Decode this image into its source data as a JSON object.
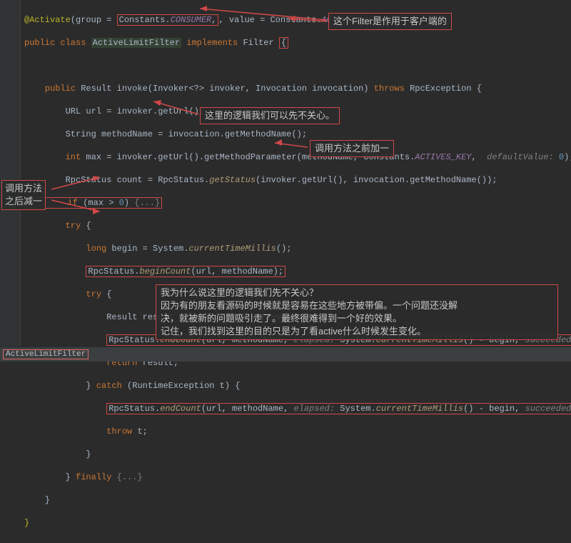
{
  "code": {
    "l1a": "@Activate",
    "l1b": "(group = ",
    "l1c": "Constants.",
    "l1d": "CONSUMER",
    "l1e": ", value = Constants.",
    "l1f": "ACTIVES_KEY",
    "l1g": ")",
    "l2a": "public class ",
    "l2b": "ActiveLimitFilter",
    "l2c": " implements ",
    "l2d": "Filter ",
    "l2e": "{",
    "l3": "",
    "l4a": "    public ",
    "l4b": "Result invoke(Invoker<?> invoker, Invocation invocation) ",
    "l4c": "throws ",
    "l4d": "RpcException {",
    "l5": "        URL url = invoker.getUrl();",
    "l6": "        String methodName = invocation.getMethodName();",
    "l7a": "        int ",
    "l7b": "max = invoker.getUrl().getMethodParameter(methodName, Constants.",
    "l7c": "ACTIVES_KEY",
    "l7d": ",  ",
    "l7e": "defaultValue:",
    "l7f": " 0",
    "l7g": ");",
    "l8a": "        RpcStatus count = RpcStatus.",
    "l8b": "getStatus",
    "l8c": "(invoker.getUrl(), invocation.getMethodName());",
    "l9a": "        if ",
    "l9b": "(max > ",
    "l9c": "0",
    "l9d": ") ",
    "l9e": "{...}",
    "l10a": "        try ",
    "l10b": "{",
    "l11a": "            long ",
    "l11b": "begin = System.",
    "l11c": "currentTimeMillis",
    "l11d": "();",
    "l12a": "            RpcStatus.",
    "l12b": "beginCount",
    "l12c": "(url, methodName);",
    "l13a": "            try ",
    "l13b": "{",
    "l14": "                Result result = invoker.invoke(invocation);",
    "l15a": "                RpcStatus.",
    "l15b": "endCount",
    "l15c": "(url, methodName, ",
    "l15d": "elapsed:",
    "l15e": " System.",
    "l15f": "currentTimeMillis",
    "l15g": "() - begin, ",
    "l15h": "succeeded:",
    "l15i": " true",
    "l15j": ");",
    "l16a": "                return ",
    "l16b": "result;",
    "l17a": "            } ",
    "l17b": "catch ",
    "l17c": "(RuntimeException t) {",
    "l18a": "                RpcStatus.",
    "l18b": "endCount",
    "l18c": "(url, methodName, ",
    "l18d": "elapsed:",
    "l18e": " System.",
    "l18f": "currentTimeMillis",
    "l18g": "() - begin, ",
    "l18h": "succeeded:",
    "l18i": " false",
    "l18j": ");",
    "l19a": "                throw ",
    "l19b": "t;",
    "l20": "            }",
    "l21a": "        } ",
    "l21b": "finally ",
    "l21c": "{...}",
    "l22": "    }",
    "l23": "}"
  },
  "notes": {
    "n1": "这个Filter是作用于客户端的",
    "n2": "这里的逻辑我们可以先不关心。",
    "n3": "调用方法之前加一",
    "n4l1": "调用方法",
    "n4l2": "之后减一",
    "n5l1": "我为什么说这里的逻辑我们先不关心？",
    "n5l2": "因为有的朋友看源码的时候就是容易在这些地方被带偏。一个问题还没解",
    "n5l3": "决，就被新的问题吸引走了。最终很难得到一个好的效果。",
    "n5l4": "记住，我们找到这里的目的只是为了看active什么时候发生变化。"
  },
  "crumb": "ActiveLimitFilter"
}
